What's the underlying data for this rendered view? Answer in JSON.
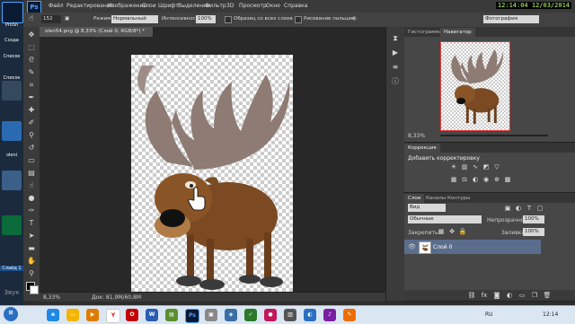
{
  "desktop": {
    "labels": [
      "ProSh",
      "Созда",
      "Список",
      "Список",
      "oleni",
      "Слайд 1",
      "Звук"
    ]
  },
  "menubar": {
    "logo": "Ps",
    "items": [
      "Файл",
      "Редактирование",
      "Изображение",
      "Слои",
      "Шрифт",
      "Выделение",
      "Фильтр",
      "3D",
      "Просмотр",
      "Окно",
      "Справка"
    ],
    "clock": "12:14:04  12/03/2014"
  },
  "options": {
    "brush_size": "152",
    "mode_label": "Режим:",
    "mode_value": "Нормальный",
    "intensity_label": "Интенсивность:",
    "intensity_value": "100%",
    "sample_all": "Образец со всех слоев",
    "finger_paint": "Рисование пальцем",
    "workspace": "Фотография"
  },
  "document": {
    "tab_title": "olen54.png @ 8,33% (Слой 0, RGB/8*) *",
    "zoom": "8,33%",
    "doc_info": "Док: 81,9M/60,8M"
  },
  "navigator": {
    "tabs": [
      "Гистограмма",
      "Навигатор"
    ],
    "zoom": "8,33%"
  },
  "corrections": {
    "tab": "Коррекция",
    "title": "Добавить корректировку"
  },
  "layers": {
    "tabs": [
      "Слои",
      "Каналы",
      "Контуры"
    ],
    "kind": "Вид",
    "blend_mode": "Обычные",
    "opacity_label": "Непрозрачность:",
    "opacity_value": "100%",
    "lock_label": "Закрепить:",
    "fill_label": "Заливка:",
    "fill_value": "100%",
    "layer_name": "Слой 0"
  },
  "taskbar": {
    "time": "12:14",
    "lang": "RU"
  },
  "colors": {
    "ps_blue": "#4aa3ff",
    "selected_layer": "#5a6d8c",
    "navigator_frame": "#e23b3b"
  }
}
